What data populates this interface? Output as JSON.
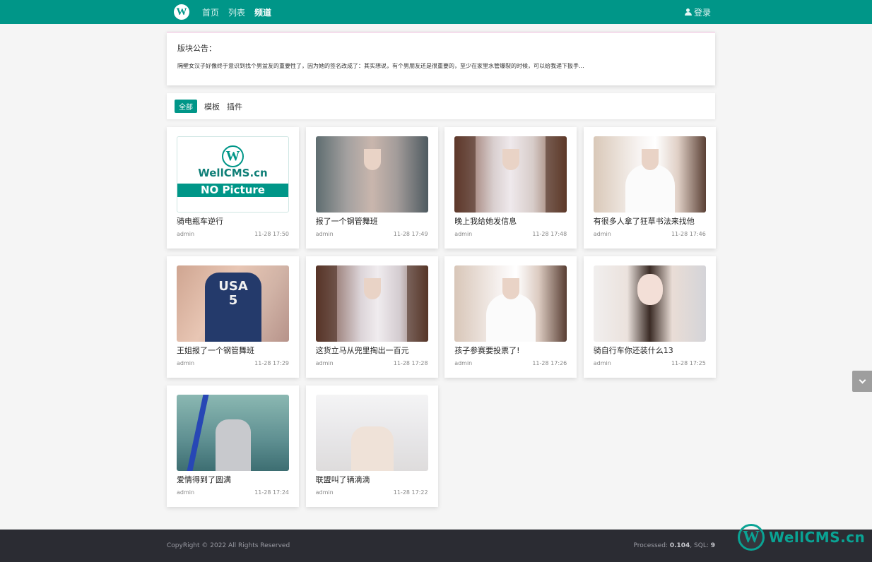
{
  "header": {
    "logo_letter": "W",
    "nav": [
      {
        "label": "首页",
        "active": false
      },
      {
        "label": "列表",
        "active": false
      },
      {
        "label": "频道",
        "active": true
      }
    ],
    "login_label": "登录"
  },
  "notice": {
    "title": "版块公告：",
    "text": "隔壁女汉子好像终于意识到找个男盆友的重要性了，因为她的签名改成了：其实想说，有个男朋友还是很重要的，至少在家里水管爆裂的时候，可以给我递下扳手..."
  },
  "filters": [
    {
      "label": "全部",
      "active": true
    },
    {
      "label": "模板",
      "active": false
    },
    {
      "label": "插件",
      "active": false
    }
  ],
  "nopic": {
    "letter": "W",
    "brand": "WellCMS.cn",
    "label": "NO Picture"
  },
  "posts": [
    {
      "title": "骑电瓶车逆行",
      "author": "admin",
      "time": "11-28 17:50"
    },
    {
      "title": "报了一个钢管舞班",
      "author": "admin",
      "time": "11-28 17:49"
    },
    {
      "title": "晚上我给她发信息",
      "author": "admin",
      "time": "11-28 17:48"
    },
    {
      "title": "有很多人拿了狂草书法来找他",
      "author": "admin",
      "time": "11-28 17:46"
    },
    {
      "title": "王姐报了一个钢管舞班",
      "author": "admin",
      "time": "11-28 17:29"
    },
    {
      "title": "这货立马从兜里掏出一百元",
      "author": "admin",
      "time": "11-28 17:28"
    },
    {
      "title": "孩子参赛要投票了!",
      "author": "admin",
      "time": "11-28 17:26"
    },
    {
      "title": "骑自行车你还装什么13",
      "author": "admin",
      "time": "11-28 17:25"
    },
    {
      "title": "爱情得到了圆满",
      "author": "admin",
      "time": "11-28 17:24"
    },
    {
      "title": "联盟叫了辆滴滴",
      "author": "admin",
      "time": "11-28 17:22"
    }
  ],
  "thumb_text": {
    "usa": "USA",
    "usa_number": "5"
  },
  "footer": {
    "copyright": "CopyRight © 2022 All Rights Reserved",
    "processed_label": "Processed: ",
    "processed_value": "0.104",
    "sql_label": ", SQL: ",
    "sql_value": "9"
  },
  "watermark": {
    "letter": "W",
    "text": "WellCMS.cn"
  },
  "colors": {
    "brand": "#009688",
    "footer_bg": "#2b2c33",
    "page_bg": "#f5f5f5"
  },
  "icons": [
    "user-icon",
    "chevron-down-icon",
    "wellcms-logo-icon"
  ]
}
